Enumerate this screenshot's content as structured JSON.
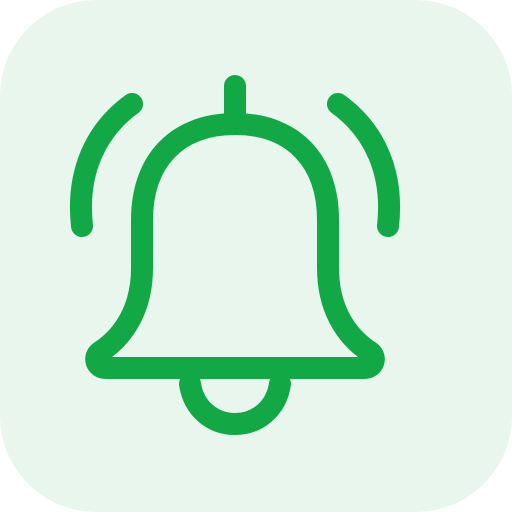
{
  "icon": {
    "name": "bell-ringing-icon",
    "colors": {
      "background": "#E8F6EE",
      "stroke": "#13A846"
    }
  }
}
